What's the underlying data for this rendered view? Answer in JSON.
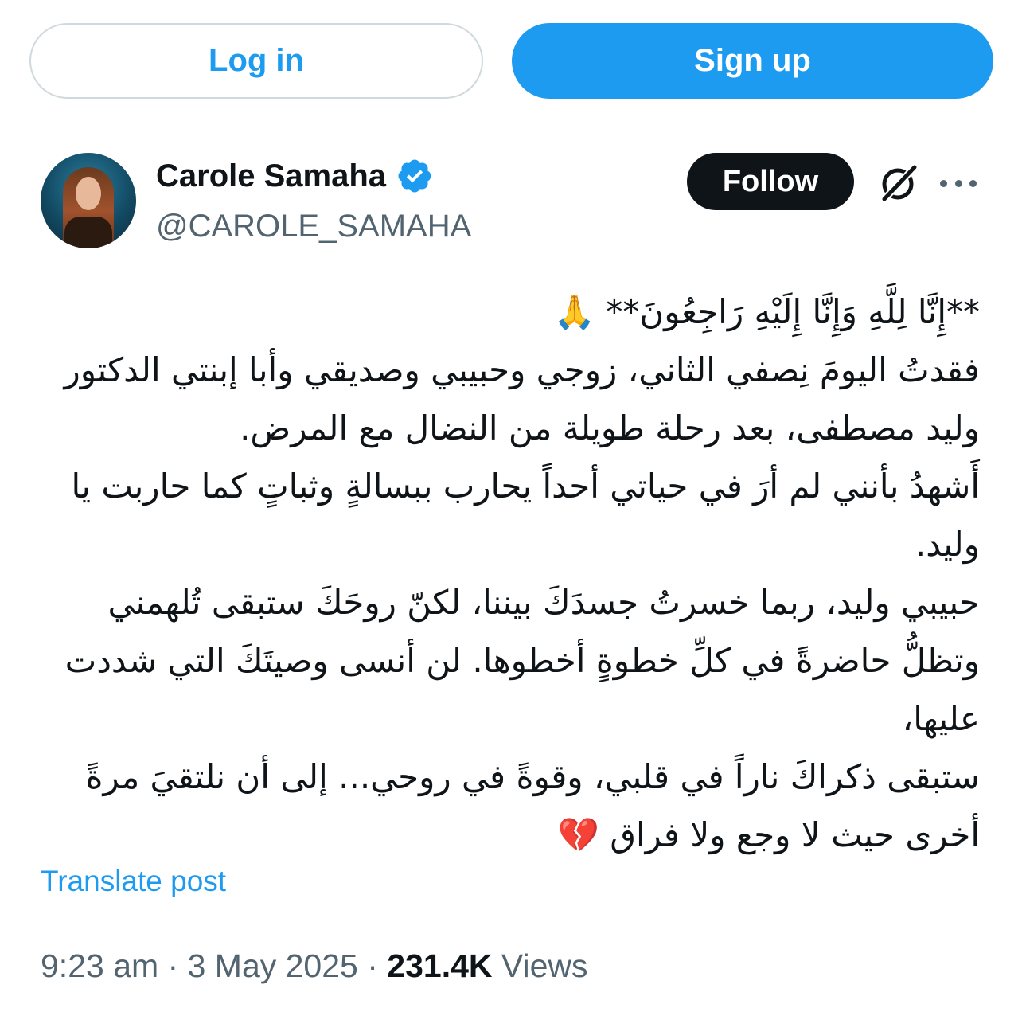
{
  "auth": {
    "login_label": "Log in",
    "signup_label": "Sign up"
  },
  "author": {
    "name": "Carole Samaha",
    "handle": "@CAROLE_SAMAHA",
    "verified": true
  },
  "actions": {
    "follow_label": "Follow"
  },
  "tweet": {
    "lines": [
      "**إِنَّا لِلَّهِ وَإِنَّا إِلَيْهِ رَاجِعُونَ** 🙏",
      "فقدتُ اليومَ نِصفي الثاني، زوجي وحبيبي وصديقي وأبا إبنتي الدكتور وليد مصطفى، بعد رحلة طويلة من النضال مع المرض.",
      "أَشهدُ بأنني لم أرَ في حياتي أحداً يحارب ببسالةٍ وثباتٍ كما حاربت يا وليد.",
      "حبيبي وليد، ربما خسرتُ جسدَكَ بيننا، لكنّ روحَكَ ستبقى تُلهمني وتظلُّ حاضرةً في كلِّ خطوةٍ أخطوها. لن أنسى وصيتَكَ التي شددت عليها،",
      "ستبقى ذكراكَ ناراً في قلبي، وقوةً في روحي... إلى أن نلتقيَ مرةً أخرى حيث لا وجع ولا فراق 💔"
    ]
  },
  "translate_label": "Translate post",
  "meta": {
    "time": "9:23 am",
    "separator": " · ",
    "date": "3 May 2025",
    "views_count": "231.4K",
    "views_label": "Views"
  },
  "colors": {
    "accent": "#1d9bf0",
    "text": "#0f1419",
    "secondary": "#536471",
    "border": "#cfd9de"
  },
  "icons": {
    "verified": "verified-badge-icon",
    "grok": "grok-icon",
    "more": "more-icon"
  }
}
